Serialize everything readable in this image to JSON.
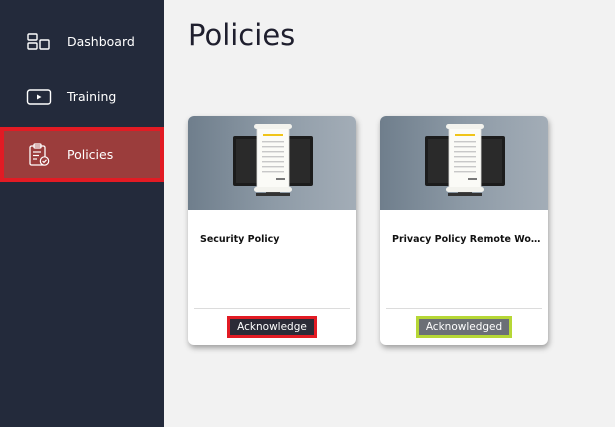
{
  "sidebar": {
    "items": [
      {
        "label": "Dashboard",
        "icon": "dashboard-icon",
        "active": false
      },
      {
        "label": "Training",
        "icon": "video-play-icon",
        "active": false
      },
      {
        "label": "Policies",
        "icon": "clipboard-check-icon",
        "active": true
      }
    ]
  },
  "main": {
    "title": "Policies",
    "cards": [
      {
        "title": "Security Policy",
        "action_label": "Acknowledge",
        "status": "pending"
      },
      {
        "title": "Privacy Policy Remote Wor...",
        "action_label": "Acknowledged",
        "status": "done"
      }
    ]
  },
  "colors": {
    "sidebar_bg": "#232a3b",
    "active_item_bg": "#9b3d3c",
    "highlight_red": "#e21b24",
    "highlight_green": "#b6d736",
    "page_bg": "#f2f2f2"
  }
}
